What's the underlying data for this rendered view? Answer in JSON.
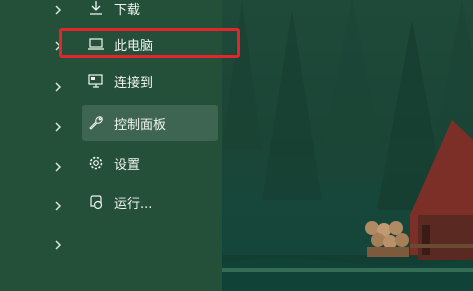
{
  "menu": {
    "items": [
      {
        "label": "下载",
        "icon": "download-icon"
      },
      {
        "label": "此电脑",
        "icon": "laptop-icon"
      },
      {
        "label": "连接到",
        "icon": "connect-icon"
      },
      {
        "label": "控制面板",
        "icon": "wrench-icon"
      },
      {
        "label": "设置",
        "icon": "gear-icon"
      },
      {
        "label": "运行...",
        "icon": "run-icon"
      }
    ]
  },
  "colors": {
    "highlight": "#e3262b",
    "menu_bg": "#24503a"
  }
}
